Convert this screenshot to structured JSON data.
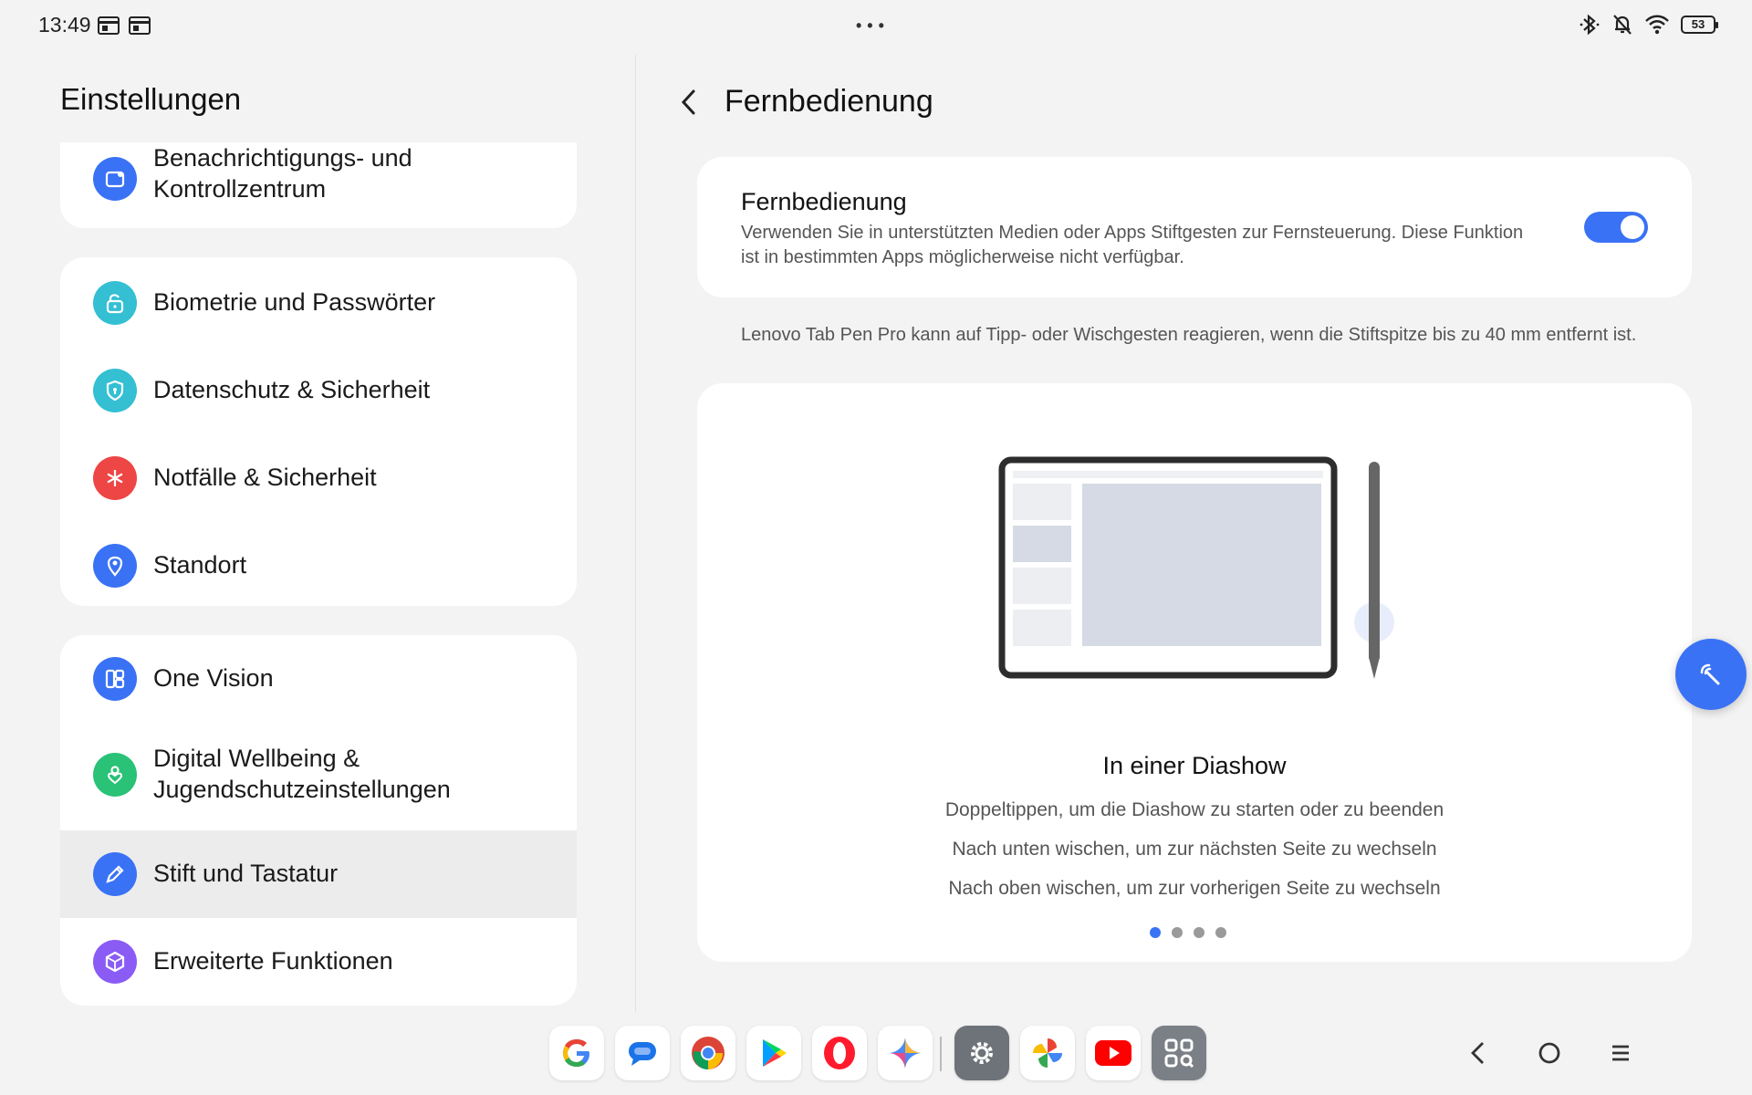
{
  "status_bar": {
    "time": "13:49",
    "battery": "53"
  },
  "left_panel": {
    "title": "Einstellungen",
    "items": [
      {
        "label_line1": "Benachrichtigungs- und",
        "label_line2": "Kontrollzentrum",
        "icon": "notification-center-icon",
        "color": "#3a72f5"
      },
      {
        "label": "Biometrie und Passwörter",
        "icon": "unlock-icon",
        "color": "#34bfd3"
      },
      {
        "label": "Datenschutz & Sicherheit",
        "icon": "shield-icon",
        "color": "#34bfd3"
      },
      {
        "label": "Notfälle & Sicherheit",
        "icon": "asterisk-icon",
        "color": "#ee4545"
      },
      {
        "label": "Standort",
        "icon": "location-pin-icon",
        "color": "#3a72f5"
      },
      {
        "label": "One Vision",
        "icon": "one-vision-icon",
        "color": "#3a72f5"
      },
      {
        "label_line1": "Digital Wellbeing &",
        "label_line2": "Jugendschutzeinstellungen",
        "icon": "wellbeing-icon",
        "color": "#29c277"
      },
      {
        "label": "Stift und Tastatur",
        "icon": "pen-icon",
        "color": "#3a72f5",
        "selected": true
      },
      {
        "label": "Erweiterte Funktionen",
        "icon": "advanced-features-icon",
        "color": "#8a5cf5"
      }
    ]
  },
  "right_panel": {
    "title": "Fernbedienung",
    "toggle_card": {
      "title": "Fernbedienung",
      "description": "Verwenden Sie in unterstützten Medien oder Apps Stiftgesten zur Fernsteuerung. Diese Funktion ist in bestimmten Apps möglicherweise nicht verfügbar.",
      "enabled": true
    },
    "hint": "Lenovo Tab Pen Pro kann auf Tipp- oder Wischgesten reagieren, wenn die Stiftspitze bis zu 40 mm entfernt ist.",
    "demo": {
      "title": "In einer Diashow",
      "lines": [
        "Doppeltippen, um die Diashow zu starten oder zu beenden",
        "Nach unten wischen, um zur nächsten Seite zu wechseln",
        "Nach oben wischen, um zur vorherigen Seite zu wechseln"
      ],
      "page_count": 4,
      "active_page": 1
    }
  },
  "dock": {
    "apps": [
      "google-icon",
      "messages-icon",
      "chrome-icon",
      "play-store-icon",
      "opera-icon",
      "gemini-icon",
      "settings-icon",
      "photos-icon",
      "youtube-icon",
      "app-library-icon"
    ]
  },
  "colors": {
    "accent": "#3a72f5",
    "background": "#f3f3f3",
    "card": "#ffffff"
  }
}
